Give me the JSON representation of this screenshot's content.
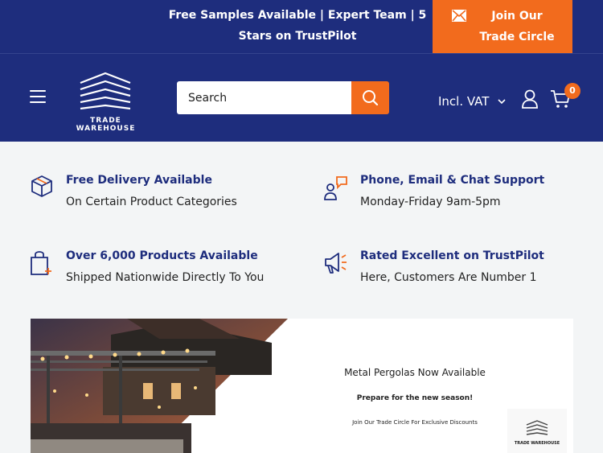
{
  "topbar": {
    "message": "Free Samples Available | Expert Team | 5 Stars on TrustPilot",
    "join_label": "Join Our Trade Circle"
  },
  "header": {
    "logo_text": "TRADE WAREHOUSE",
    "search_placeholder": "Search",
    "vat_label": "Incl. VAT",
    "cart_count": "0"
  },
  "features": [
    {
      "title": "Free Delivery Available",
      "subtitle": "On Certain Product Categories",
      "icon": "box-icon"
    },
    {
      "title": "Phone, Email & Chat Support",
      "subtitle": "Monday-Friday 9am-5pm",
      "icon": "support-chat-icon"
    },
    {
      "title": "Over 6,000 Products Available",
      "subtitle": "Shipped Nationwide Directly To You",
      "icon": "shopping-bag-plus-icon"
    },
    {
      "title": "Rated Excellent on TrustPilot",
      "subtitle": "Here, Customers Are Number 1",
      "icon": "megaphone-icon"
    }
  ],
  "banner": {
    "title": "Metal Pergolas Now Available",
    "subtitle": "Prepare for the new season!",
    "cta": "Join Our Trade Circle For Exclusive Discounts",
    "logo_text": "TRADE WAREHOUSE"
  },
  "colors": {
    "navy": "#1e2d7d",
    "orange": "#f26b1d",
    "page_bg": "#f3f5f6"
  }
}
